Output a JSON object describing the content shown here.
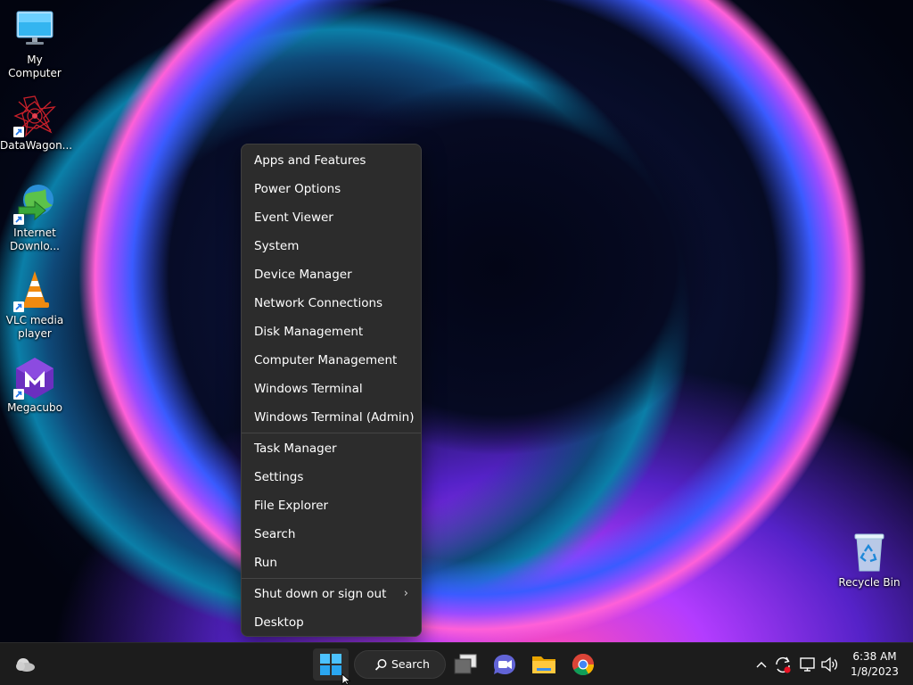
{
  "desktop": {
    "icons": [
      {
        "label": "My Computer",
        "icon": "monitor-icon"
      },
      {
        "label": "DataWagon...",
        "icon": "datawagon-logo-icon"
      },
      {
        "label": "Internet Downlo...",
        "icon": "internet-download-manager-icon"
      },
      {
        "label": "VLC media player",
        "icon": "vlc-cone-icon"
      },
      {
        "label": "Megacubo",
        "icon": "megacubo-icon"
      },
      {
        "label": "Recycle Bin",
        "icon": "recycle-bin-icon"
      }
    ]
  },
  "context_menu": {
    "groups": [
      [
        "Apps and Features",
        "Power Options",
        "Event Viewer",
        "System",
        "Device Manager",
        "Network Connections",
        "Disk Management",
        "Computer Management",
        "Windows Terminal",
        "Windows Terminal (Admin)"
      ],
      [
        "Task Manager",
        "Settings",
        "File Explorer",
        "Search",
        "Run"
      ],
      [
        "Shut down or sign out",
        "Desktop"
      ]
    ],
    "submenu_chevron": "›"
  },
  "taskbar": {
    "search_label": "Search",
    "pinned_icons": [
      "weather-icon",
      "windows-start-icon",
      "search-icon",
      "task-view-icon",
      "teams-chat-icon",
      "file-explorer-icon",
      "chrome-icon"
    ],
    "tray_icons": [
      "chevron-up-icon",
      "sync-alert-icon",
      "network-icon",
      "volume-icon"
    ],
    "clock": {
      "time": "6:38 AM",
      "date": "1/8/2023"
    }
  },
  "colors": {
    "menu_bg": "#2c2c2c",
    "taskbar_bg": "#1c1c1c",
    "accent_blue": "#0078d4"
  }
}
